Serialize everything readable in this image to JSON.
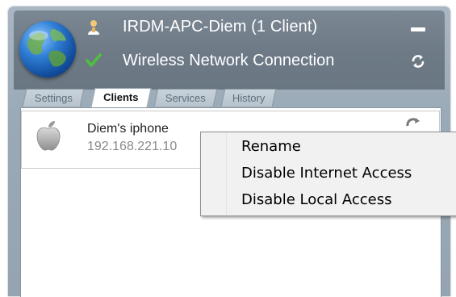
{
  "window": {
    "title": "IRDM-APC-Diem (1 Client)",
    "connection": "Wireless Network Connection"
  },
  "tabs": [
    {
      "label": "Settings",
      "active": false
    },
    {
      "label": "Clients",
      "active": true
    },
    {
      "label": "Services",
      "active": false
    },
    {
      "label": "History",
      "active": false
    }
  ],
  "clients": [
    {
      "name": "Diem's iphone",
      "ip": "192.168.221.10",
      "icon": "apple-icon"
    }
  ],
  "context_menu": {
    "items": [
      "Rename",
      "Disable Internet Access",
      "Disable Local Access"
    ]
  },
  "icons": {
    "header": "globe-icon",
    "user": "user-icon",
    "status": "check-icon",
    "minimize": "minimize-icon",
    "refresh": "refresh-icon"
  },
  "colors": {
    "header_bg": "#6d7a86",
    "frame_bg": "#9aa9b6",
    "status_ok": "#4cc23a",
    "user_icon": "#f0c36a"
  }
}
